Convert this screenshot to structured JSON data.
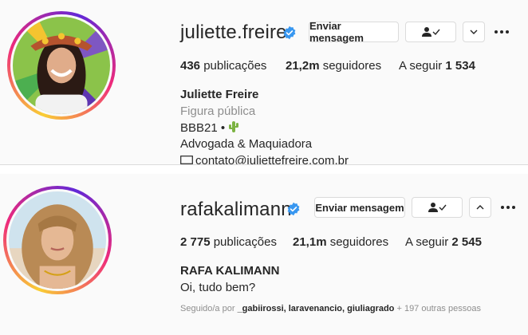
{
  "profiles": [
    {
      "username": "juliette.freire",
      "message_button": "Enviar mensagem",
      "following_icon": "person-check-icon",
      "menu_chevron": "chevron-down-icon",
      "stats": {
        "posts_value": "436",
        "posts_label": "publicações",
        "followers_value": "21,2m",
        "followers_label": "seguidores",
        "following_label": "A seguir",
        "following_value": "1 534"
      },
      "full_name": "Juliette Freire",
      "category": "Figura pública",
      "bio_line1": "BBB21 •",
      "bio_line1_emoji": "cactus-icon",
      "bio_line2": "Advogada & Maquiadora",
      "bio_line3": "contato@juliettefreire.com.br",
      "bio_line3_icon": "envelope-icon"
    },
    {
      "username": "rafakalimann",
      "message_button": "Enviar mensagem",
      "following_icon": "person-check-icon",
      "menu_chevron": "chevron-up-icon",
      "stats": {
        "posts_value": "2 775",
        "posts_label": "publicações",
        "followers_value": "21,1m",
        "followers_label": "seguidores",
        "following_label": "A seguir",
        "following_value": "2 545"
      },
      "full_name": "RAFA KALIMANN",
      "bio_line1": "Oi, tudo bem?",
      "followed_by_prefix": "Seguido/a por",
      "followed_by_names": "_gabiirossi, laravenancio, giuliagrado",
      "followed_by_suffix": "+ 197 outras pessoas"
    }
  ],
  "colors": {
    "verified_blue": "#3897f0",
    "text": "#262626",
    "muted": "#8e8e8e",
    "border": "#dbdbdb"
  }
}
